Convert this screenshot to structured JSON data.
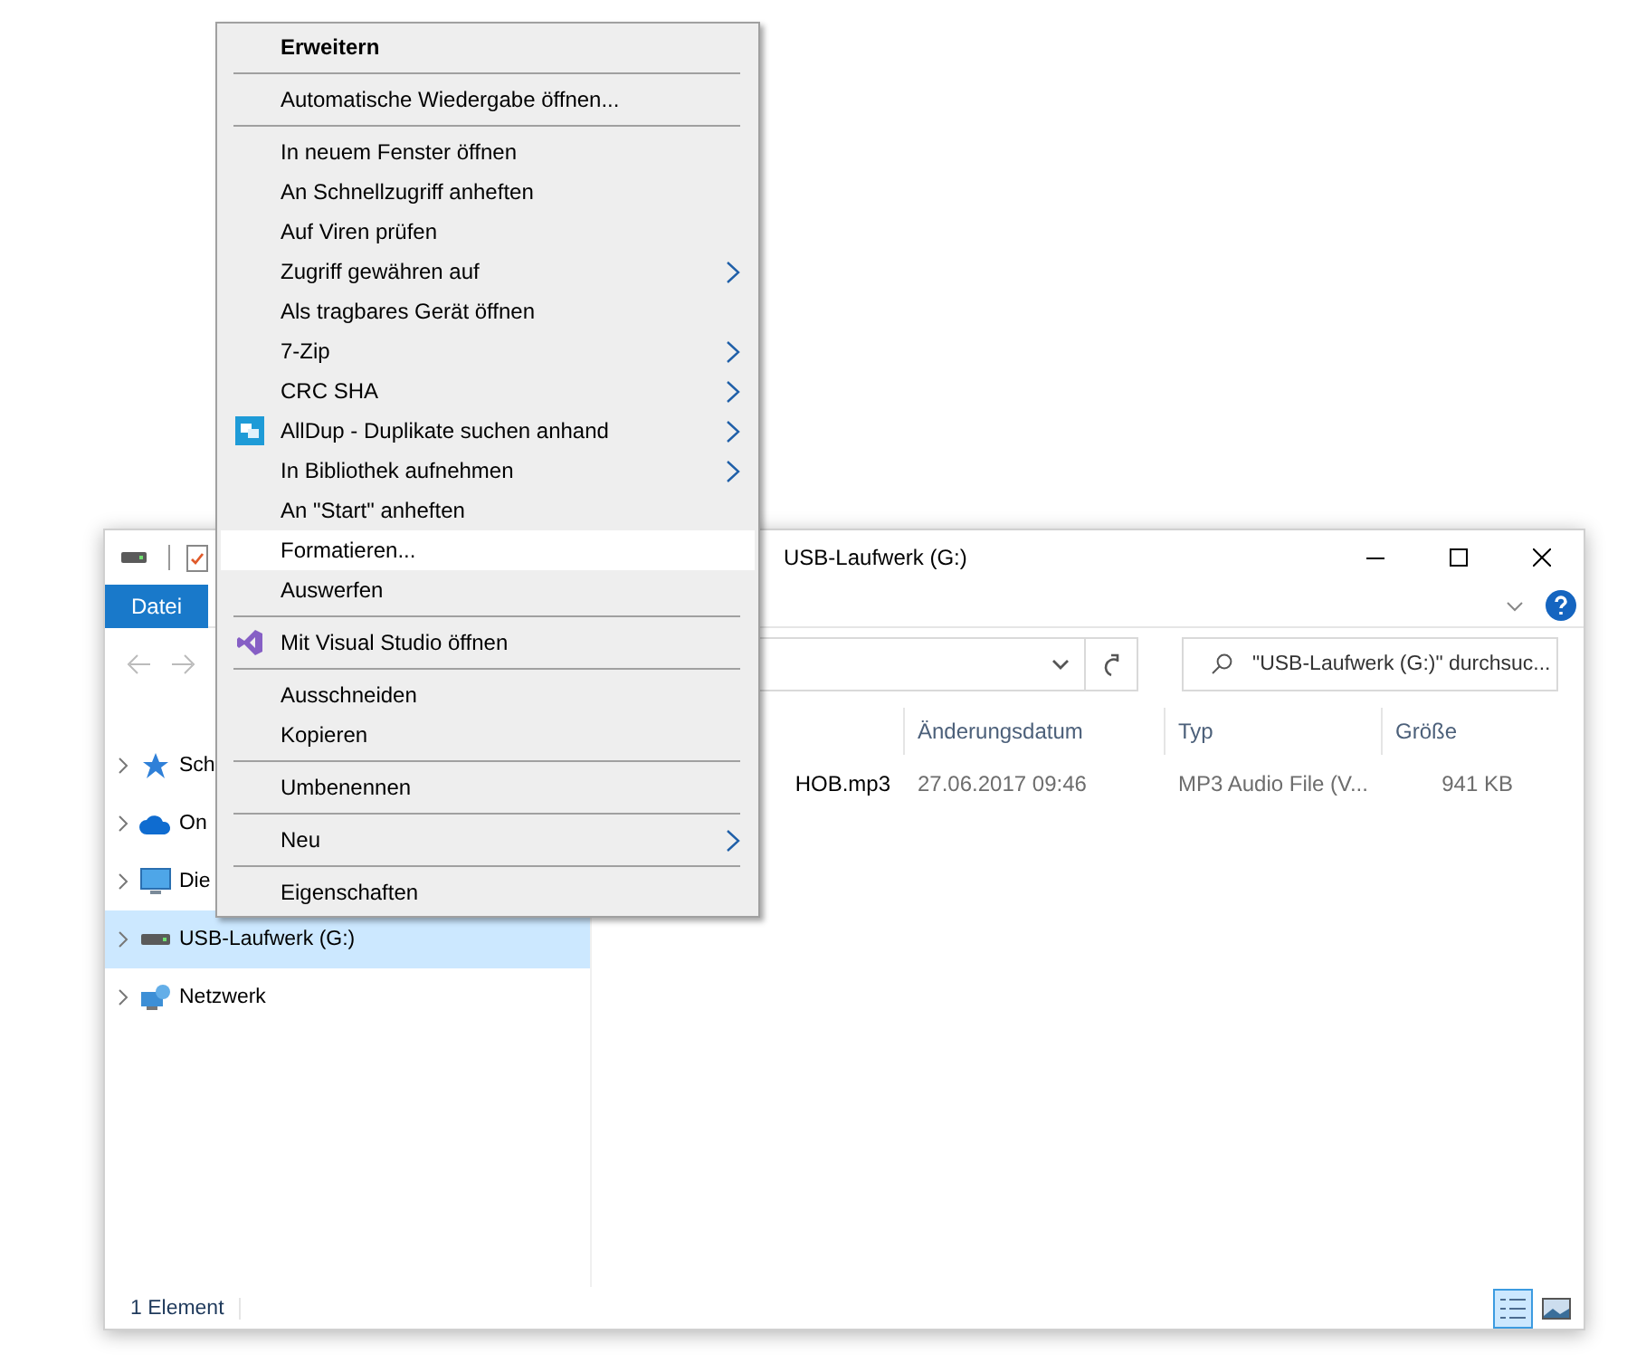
{
  "window": {
    "title": "USB-Laufwerk (G:)"
  },
  "ribbon": {
    "tabs": [
      {
        "label": "Datei",
        "selected": true
      }
    ]
  },
  "search": {
    "placeholder": "\"USB-Laufwerk (G:)\" durchsuc..."
  },
  "sidebar": {
    "items": [
      {
        "label": "Sch",
        "kind": "star",
        "selected": false
      },
      {
        "label": "On",
        "kind": "cloud",
        "selected": false
      },
      {
        "label": "Die",
        "kind": "monitor",
        "selected": false
      },
      {
        "label": "USB-Laufwerk (G:)",
        "kind": "drive",
        "selected": true
      },
      {
        "label": "Netzwerk",
        "kind": "network",
        "selected": false
      }
    ]
  },
  "table": {
    "columns": [
      "Änderungsdatum",
      "Typ",
      "Größe"
    ],
    "rows": [
      {
        "name": "HOB.mp3",
        "date": "27.06.2017 09:46",
        "type": "MP3 Audio File (V...",
        "size": "941 KB"
      }
    ]
  },
  "status_bar": {
    "count": "1 Element",
    "views": [
      {
        "kind": "details",
        "selected": true
      },
      {
        "kind": "tiles",
        "selected": false
      }
    ]
  },
  "context_menu": {
    "groups": [
      [
        {
          "label": "Erweitern",
          "bold": true,
          "submenu": false,
          "selected": false,
          "kind": "plain"
        }
      ],
      [
        {
          "label": "Automatische Wiedergabe öffnen...",
          "bold": false,
          "submenu": false,
          "selected": false,
          "kind": "plain"
        }
      ],
      [
        {
          "label": "In neuem Fenster öffnen",
          "bold": false,
          "submenu": false,
          "selected": false,
          "kind": "plain"
        },
        {
          "label": "An Schnellzugriff anheften",
          "bold": false,
          "submenu": false,
          "selected": false,
          "kind": "plain"
        },
        {
          "label": "Auf Viren prüfen",
          "bold": false,
          "submenu": false,
          "selected": false,
          "kind": "plain"
        },
        {
          "label": "Zugriff gewähren auf",
          "bold": false,
          "submenu": true,
          "selected": false,
          "kind": "plain"
        },
        {
          "label": "Als tragbares Gerät öffnen",
          "bold": false,
          "submenu": false,
          "selected": false,
          "kind": "plain"
        },
        {
          "label": "7-Zip",
          "bold": false,
          "submenu": true,
          "selected": false,
          "kind": "plain"
        },
        {
          "label": "CRC SHA",
          "bold": false,
          "submenu": true,
          "selected": false,
          "kind": "plain"
        },
        {
          "label": "AllDup - Duplikate suchen anhand",
          "bold": false,
          "submenu": true,
          "selected": false,
          "kind": "copies"
        },
        {
          "label": "In Bibliothek aufnehmen",
          "bold": false,
          "submenu": true,
          "selected": false,
          "kind": "plain"
        },
        {
          "label": "An \"Start\" anheften",
          "bold": false,
          "submenu": false,
          "selected": false,
          "kind": "plain"
        },
        {
          "label": "Formatieren...",
          "bold": false,
          "submenu": false,
          "selected": true,
          "kind": "plain"
        },
        {
          "label": "Auswerfen",
          "bold": false,
          "submenu": false,
          "selected": false,
          "kind": "plain"
        }
      ],
      [
        {
          "label": "Mit Visual Studio öffnen",
          "bold": false,
          "submenu": false,
          "selected": false,
          "kind": "infinity"
        }
      ],
      [
        {
          "label": "Ausschneiden",
          "bold": false,
          "submenu": false,
          "selected": false,
          "kind": "plain"
        },
        {
          "label": "Kopieren",
          "bold": false,
          "submenu": false,
          "selected": false,
          "kind": "plain"
        }
      ],
      [
        {
          "label": "Umbenennen",
          "bold": false,
          "submenu": false,
          "selected": false,
          "kind": "plain"
        }
      ],
      [
        {
          "label": "Neu",
          "bold": false,
          "submenu": true,
          "selected": false,
          "kind": "plain"
        }
      ],
      [
        {
          "label": "Eigenschaften",
          "bold": false,
          "submenu": false,
          "selected": false,
          "kind": "plain"
        }
      ]
    ]
  }
}
